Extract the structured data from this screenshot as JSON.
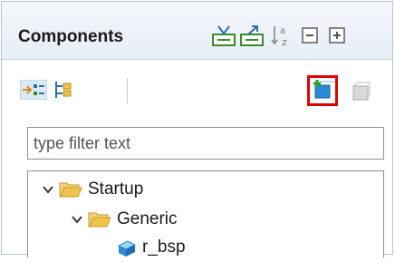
{
  "view": {
    "title": "Components"
  },
  "header_icons": [
    "collapse-to-icon",
    "expand-to-icon",
    "sort-alpha-icon",
    "collapse-all-icon",
    "expand-all-icon"
  ],
  "toolbar": {
    "buttons": [
      "link-with-editor-icon",
      "hierarchy-icon",
      "add-component-icon",
      "remove-component-icon"
    ]
  },
  "filter": {
    "placeholder": "type filter text",
    "value": ""
  },
  "tree": {
    "items": [
      {
        "label": "Startup",
        "level": 0,
        "expanded": true,
        "icon": "folder-open-icon"
      },
      {
        "label": "Generic",
        "level": 1,
        "expanded": true,
        "icon": "folder-open-icon"
      },
      {
        "label": "r_bsp",
        "level": 2,
        "expanded": false,
        "icon": "component-icon"
      }
    ]
  },
  "colors": {
    "highlight": "#e00000",
    "folder": "#f0c44c",
    "accent": "#2a8ad6"
  }
}
